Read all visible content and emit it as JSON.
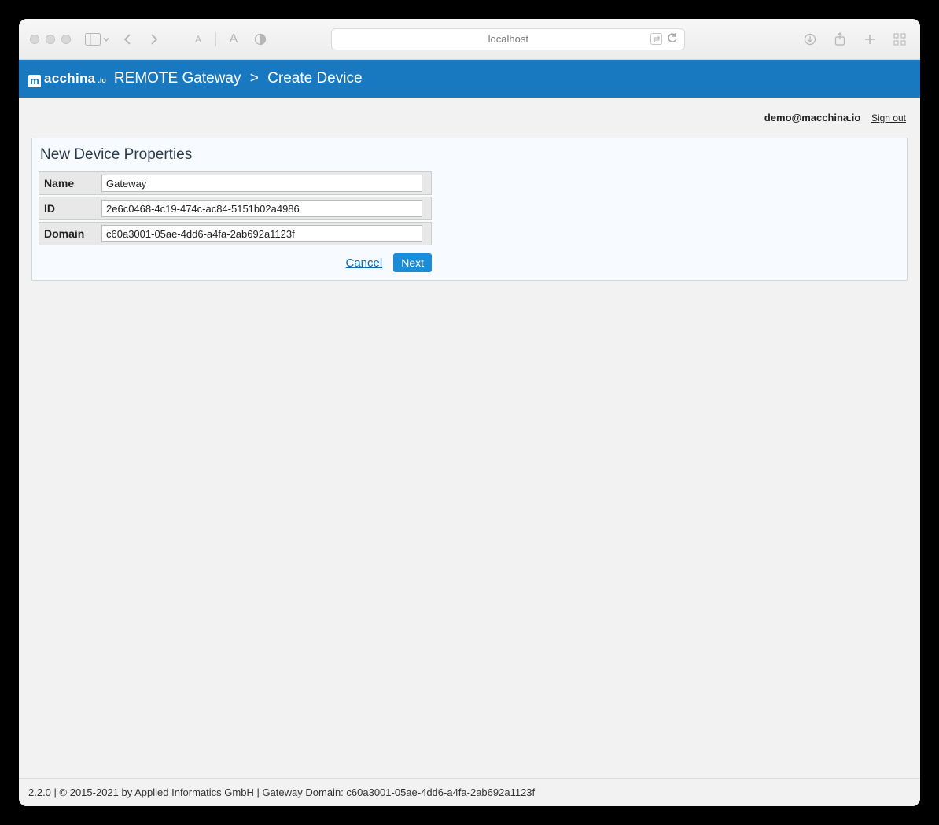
{
  "browser": {
    "url_host": "localhost"
  },
  "brand": {
    "logo_initial": "m",
    "logo_text": "acchina",
    "logo_suffix": ".io"
  },
  "breadcrumb": {
    "root": "REMOTE Gateway",
    "separator": ">",
    "page": "Create Device"
  },
  "user": {
    "email": "demo@macchina.io",
    "signout_label": "Sign out"
  },
  "panel": {
    "title": "New Device Properties",
    "fields": {
      "name": {
        "label": "Name",
        "value": "Gateway"
      },
      "id": {
        "label": "ID",
        "value": "2e6c0468-4c19-474c-ac84-5151b02a4986"
      },
      "domain": {
        "label": "Domain",
        "value": "c60a3001-05ae-4dd6-a4fa-2ab692a1123f"
      }
    },
    "actions": {
      "cancel": "Cancel",
      "next": "Next"
    }
  },
  "footer": {
    "version": "2.2.0",
    "copyright_prefix": " | © 2015-2021 by ",
    "company": "Applied Informatics GmbH",
    "domain_prefix": " | Gateway Domain: ",
    "domain_value": "c60a3001-05ae-4dd6-a4fa-2ab692a1123f"
  }
}
